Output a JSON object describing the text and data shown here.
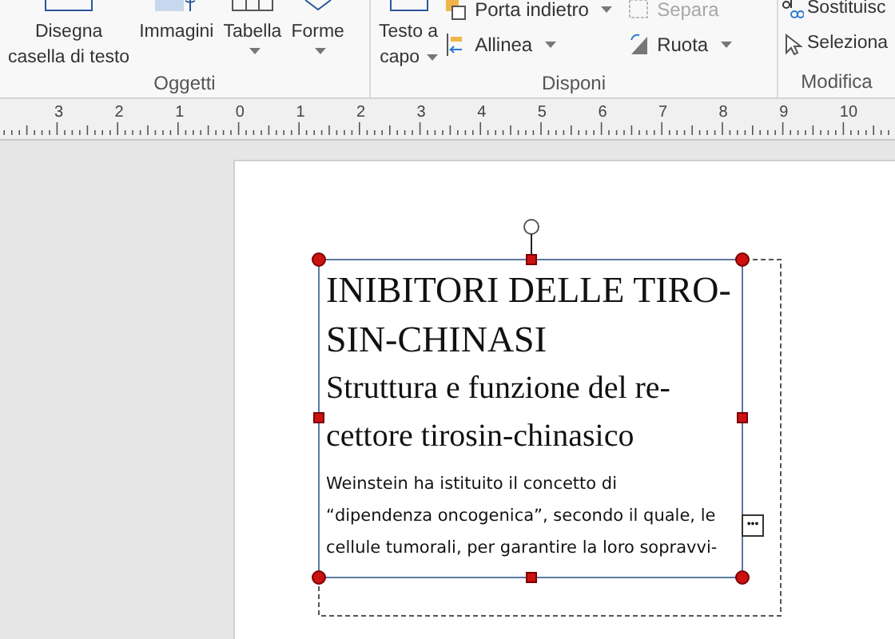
{
  "ribbon": {
    "groups": [
      {
        "label": "Oggetti",
        "buttons": [
          {
            "kind": "large",
            "label_lines": [
              "Disegna",
              "casella di testo"
            ],
            "dropdown": false,
            "disabled": false
          },
          {
            "kind": "large",
            "label_lines": [
              "Immagini"
            ],
            "dropdown": false,
            "disabled": false
          },
          {
            "kind": "large",
            "label_lines": [
              "Tabella"
            ],
            "dropdown": true,
            "disabled": false
          },
          {
            "kind": "large",
            "label_lines": [
              "Forme"
            ],
            "dropdown": true,
            "disabled": false
          }
        ]
      },
      {
        "label": "Disponi",
        "buttons": [
          {
            "kind": "large",
            "label_lines": [
              "Testo a",
              "capo"
            ],
            "dropdown": true,
            "disabled": false
          },
          {
            "kind": "small",
            "label": "Porta indietro",
            "dropdown": true,
            "disabled": false
          },
          {
            "kind": "small",
            "label": "Separa",
            "dropdown": false,
            "disabled": true
          },
          {
            "kind": "small",
            "label": "Allinea",
            "dropdown": true,
            "disabled": false
          },
          {
            "kind": "small",
            "label": "Ruota",
            "dropdown": true,
            "disabled": false
          }
        ]
      },
      {
        "label": "Modifica",
        "buttons": [
          {
            "kind": "small",
            "label": "Sostituisc",
            "dropdown": false,
            "disabled": false
          },
          {
            "kind": "small",
            "label": "Seleziona",
            "dropdown": false,
            "disabled": false
          }
        ]
      }
    ]
  },
  "ruler": {
    "labels": [
      "3",
      "2",
      "1",
      "0",
      "1",
      "2",
      "3",
      "4",
      "5",
      "6",
      "7",
      "8",
      "9",
      "10"
    ]
  },
  "text_box": {
    "title_lines": [
      "INIBITORI DELLE TIRO-",
      "SIN-CHINASI"
    ],
    "subtitle_lines": [
      "Struttura e funzione del re-",
      "cettore tirosin-chinasico"
    ],
    "body_lines": [
      "Weinstein ha istituito il concetto di",
      "“dipendenza oncogenica”, secondo il quale, le",
      "cellule tumorali, per garantire la loro sopravvi-"
    ],
    "options_button": "•••"
  }
}
